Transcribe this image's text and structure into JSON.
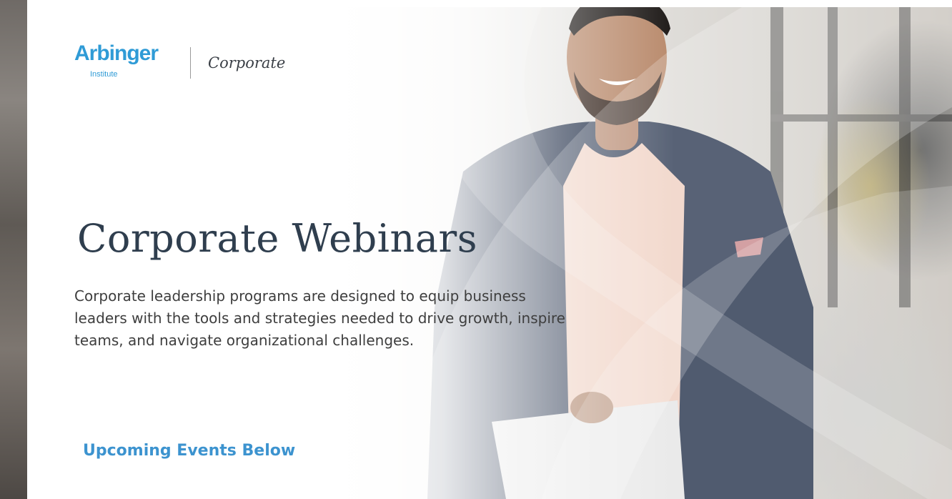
{
  "brand": {
    "name": "Arbinger",
    "sub": "Institute",
    "section": "Corporate"
  },
  "hero": {
    "title": "Corporate Webinars",
    "description": "Corporate leadership programs are designed to equip business leaders with the tools and strategies needed to drive growth, inspire teams, and navigate organizational challenges.",
    "cta": "Upcoming Events Below"
  },
  "colors": {
    "brand_blue": "#2f9bd6",
    "title": "#2f3e4e",
    "body_text": "#3e3e3e",
    "cta_blue": "#3c93cf"
  },
  "images": {
    "hero_photo": "smiling man in navy blazer and pink t-shirt holding a laptop"
  }
}
